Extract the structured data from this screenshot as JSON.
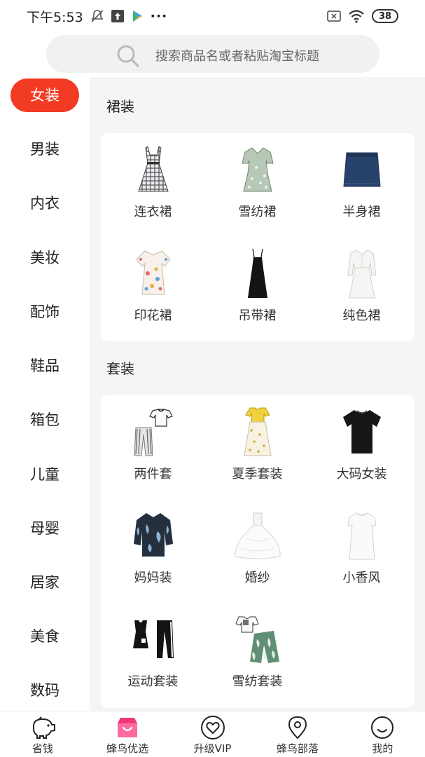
{
  "status_bar": {
    "time": "下午5:53",
    "more": "···",
    "battery": "38"
  },
  "search": {
    "placeholder": "搜索商品名或者粘贴淘宝标题"
  },
  "sidebar": {
    "items": [
      {
        "label": "女装",
        "active": true
      },
      {
        "label": "男装"
      },
      {
        "label": "内衣"
      },
      {
        "label": "美妆"
      },
      {
        "label": "配饰"
      },
      {
        "label": "鞋品"
      },
      {
        "label": "箱包"
      },
      {
        "label": "儿童"
      },
      {
        "label": "母婴"
      },
      {
        "label": "居家"
      },
      {
        "label": "美食"
      },
      {
        "label": "数码"
      }
    ],
    "active_color": "#f33a24"
  },
  "sections": [
    {
      "title": "裙装",
      "items": [
        {
          "label": "连衣裙",
          "icon": "plaid-dress-icon"
        },
        {
          "label": "雪纺裙",
          "icon": "chiffon-dress-icon"
        },
        {
          "label": "半身裙",
          "icon": "denim-skirt-icon"
        },
        {
          "label": "印花裙",
          "icon": "print-dress-icon"
        },
        {
          "label": "吊带裙",
          "icon": "slip-dress-icon"
        },
        {
          "label": "纯色裙",
          "icon": "white-dress-icon"
        }
      ]
    },
    {
      "title": "套装",
      "items": [
        {
          "label": "两件套",
          "icon": "two-piece-icon"
        },
        {
          "label": "夏季套装",
          "icon": "summer-set-icon"
        },
        {
          "label": "大码女装",
          "icon": "black-tee-icon"
        },
        {
          "label": "妈妈装",
          "icon": "mom-blouse-icon"
        },
        {
          "label": "婚纱",
          "icon": "wedding-dress-icon"
        },
        {
          "label": "小香风",
          "icon": "white-shift-dress-icon"
        },
        {
          "label": "运动套装",
          "icon": "sport-set-icon"
        },
        {
          "label": "雪纺套装",
          "icon": "chiffon-set-icon"
        }
      ]
    }
  ],
  "bottom_nav": {
    "items": [
      {
        "label": "省钱",
        "icon": "piggy-bank-icon"
      },
      {
        "label": "蜂鸟优选",
        "icon": "shop-icon"
      },
      {
        "label": "升级VIP",
        "icon": "vip-heart-icon"
      },
      {
        "label": "蜂鸟部落",
        "icon": "location-pin-icon"
      },
      {
        "label": "我的",
        "icon": "profile-icon"
      }
    ]
  }
}
